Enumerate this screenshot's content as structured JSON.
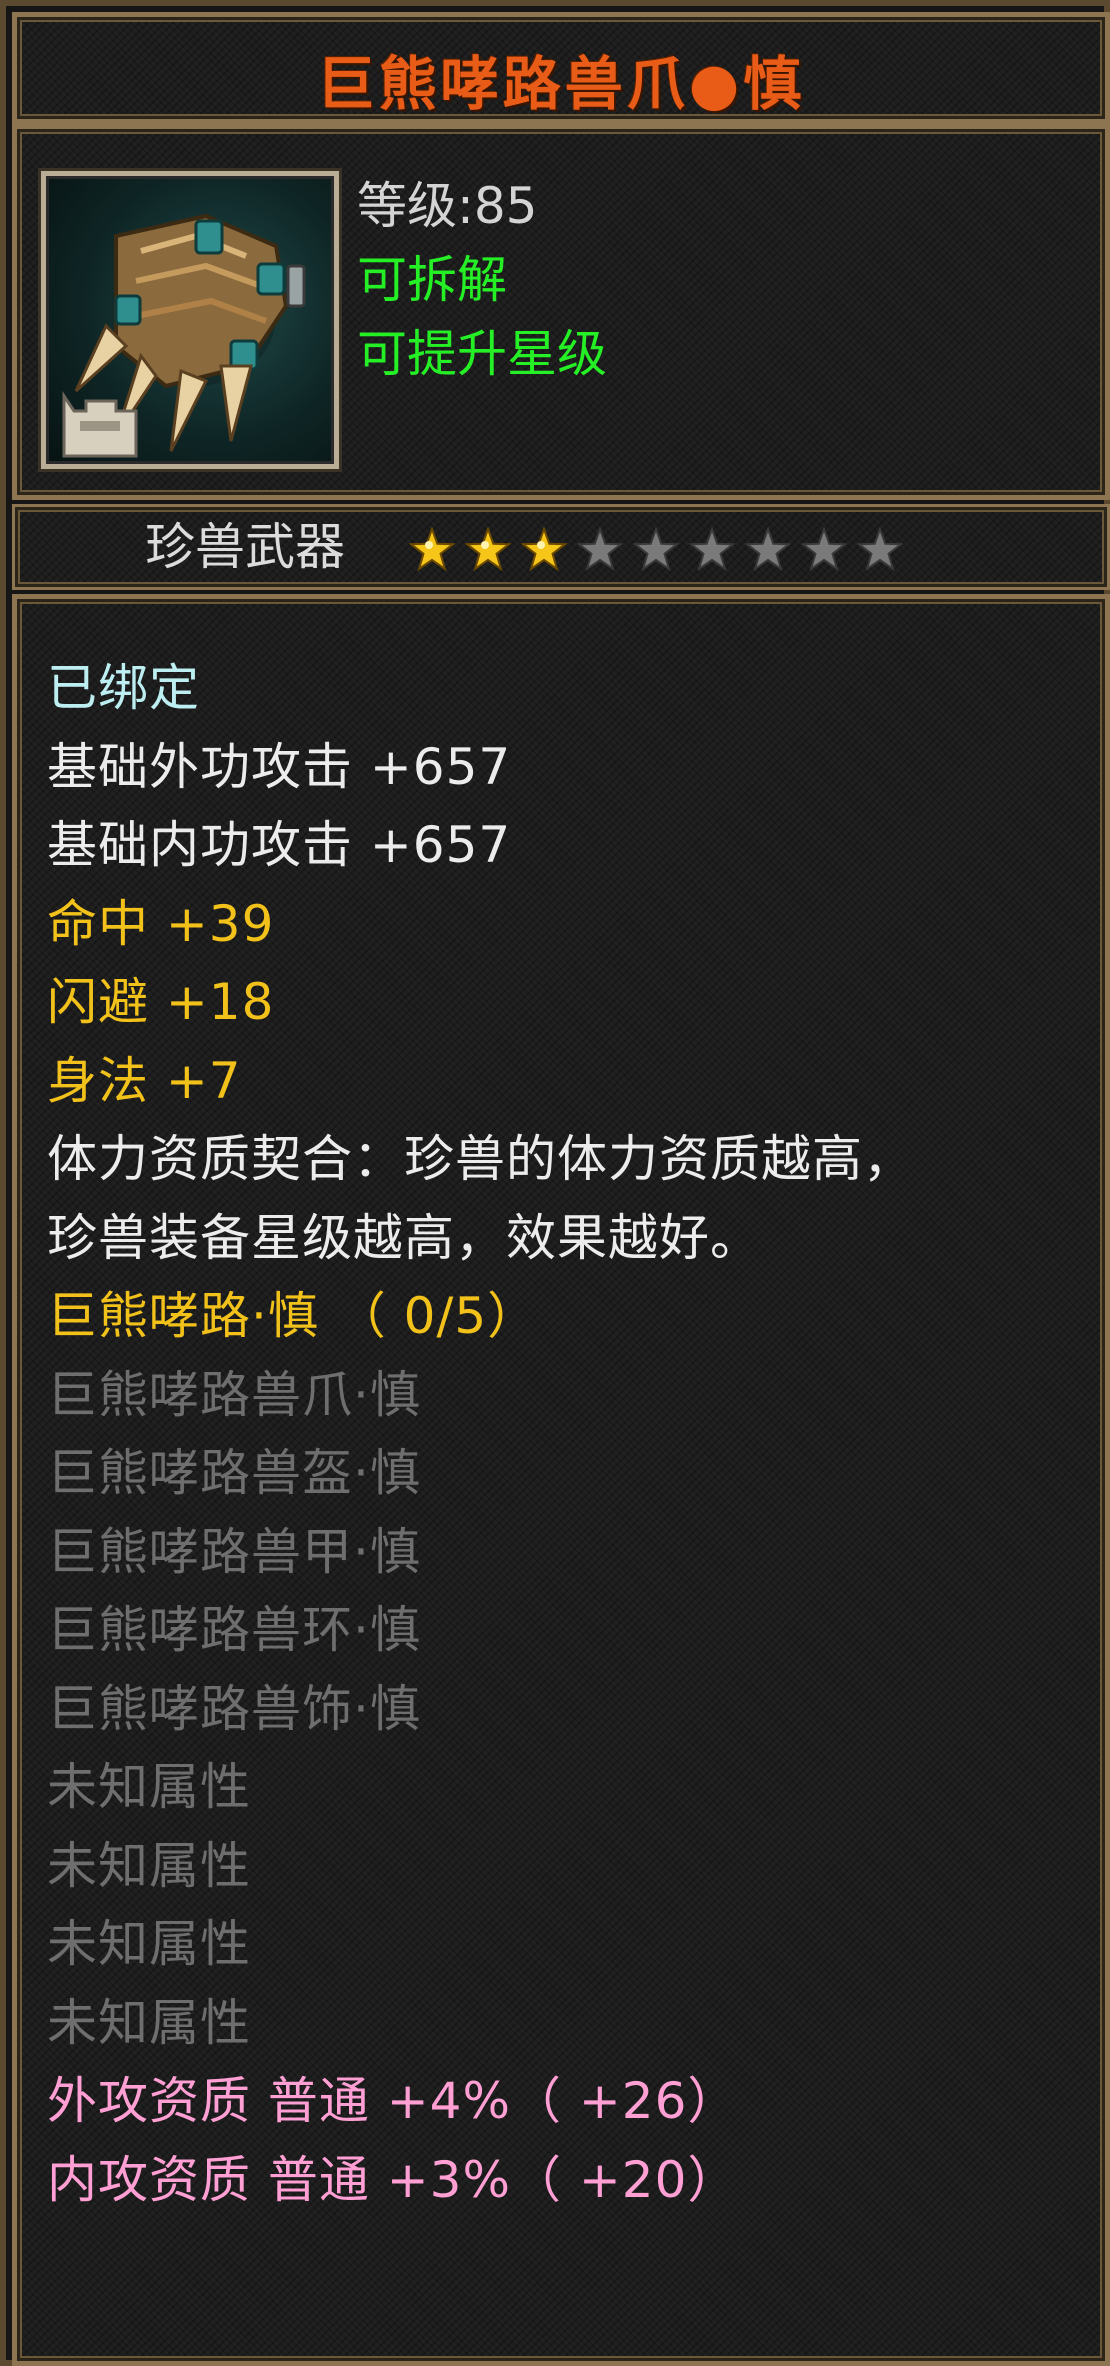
{
  "title": "巨熊哮路兽爪●慎",
  "colors": {
    "title": "#e85c18",
    "frame": "#8c7550",
    "white": "#ececec",
    "cyan": "#bdeff2",
    "yellow": "#f2c21a",
    "gray": "#6e6e6e",
    "pink": "#ff9fd4",
    "green": "#25f025",
    "star_filled": "#f5c518",
    "star_empty": "#7a7a7a"
  },
  "item": {
    "icon": "beast-claw-icon",
    "level": "等级:85",
    "dismantle": "可拆解",
    "upgrade_star": "可提升星级"
  },
  "rank": {
    "label": "珍兽武器",
    "stars_filled": 3,
    "stars_total": 9
  },
  "stats": {
    "bound": "已绑定",
    "base_ext_attack": "基础外功攻击  +657",
    "base_int_attack": "基础内功攻击  +657",
    "hit": "命中  +39",
    "dodge": "闪避  +18",
    "agility": "身法  +7",
    "desc_line1": "体力资质契合：珍兽的体力资质越高，",
    "desc_line2": "珍兽装备星级越高，效果越好。",
    "set_name": "巨熊哮路·慎 （ 0/5）",
    "set_items": [
      "巨熊哮路兽爪·慎",
      "巨熊哮路兽盔·慎",
      "巨熊哮路兽甲·慎",
      "巨熊哮路兽环·慎",
      "巨熊哮路兽饰·慎"
    ],
    "unknown_attrs": [
      "未知属性",
      "未知属性",
      "未知属性",
      "未知属性"
    ],
    "ext_quality": "外攻资质  普通 +4%（ +26）",
    "int_quality": "内攻资质  普通 +3%（ +20）"
  }
}
